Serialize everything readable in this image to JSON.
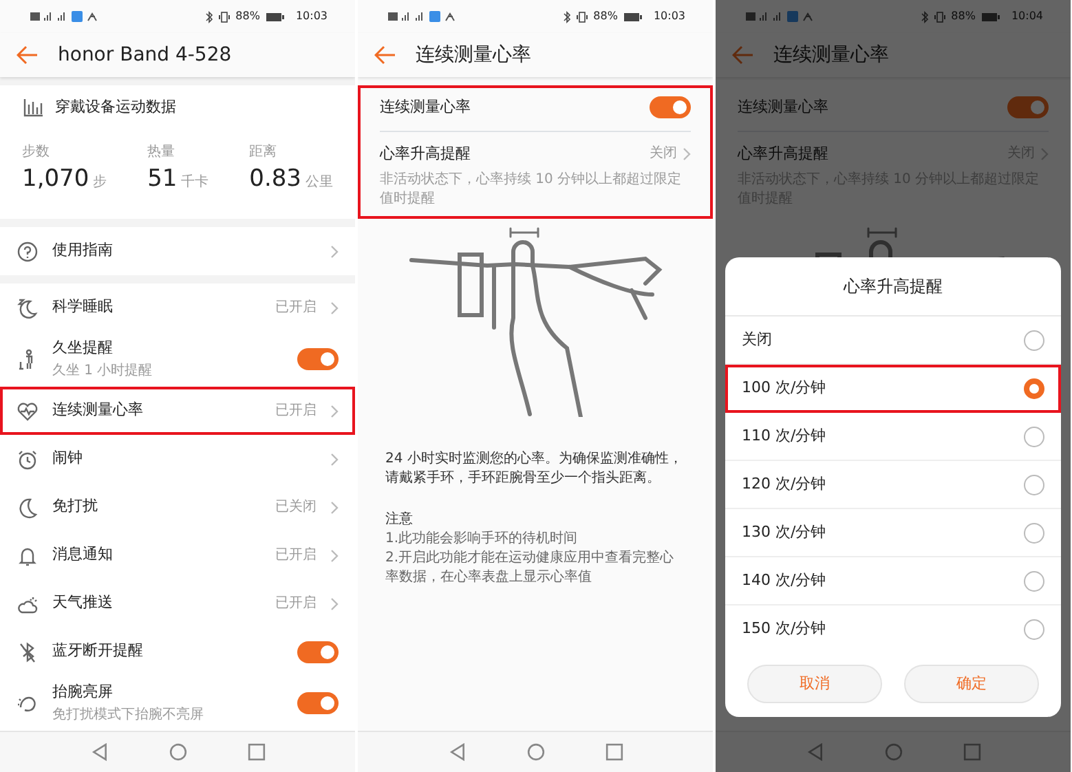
{
  "screens": [
    {
      "kind": "device",
      "status_bar": {
        "battery": "88%",
        "time": "10:03"
      },
      "header": {
        "title": "honor Band 4-528"
      },
      "stats": {
        "title": "穿戴设备运动数据",
        "metrics": [
          {
            "label": "步数",
            "value": "1,070",
            "unit": "步"
          },
          {
            "label": "热量",
            "value": "51",
            "unit": "千卡"
          },
          {
            "label": "距离",
            "value": "0.83",
            "unit": "公里"
          }
        ]
      },
      "guide": {
        "label": "使用指南"
      },
      "items": [
        {
          "kind": "link",
          "label": "科学睡眠",
          "value": "已开启",
          "highlighted": false
        },
        {
          "kind": "toggle",
          "label": "久坐提醒",
          "subtitle": "久坐 1 小时提醒",
          "on": true,
          "highlighted": false
        },
        {
          "kind": "link",
          "label": "连续测量心率",
          "value": "已开启",
          "highlighted": true
        },
        {
          "kind": "link",
          "label": "闹钟",
          "highlighted": false
        },
        {
          "kind": "link",
          "label": "免打扰",
          "value": "已关闭",
          "highlighted": false
        },
        {
          "kind": "link",
          "label": "消息通知",
          "value": "已开启",
          "highlighted": false
        },
        {
          "kind": "link",
          "label": "天气推送",
          "value": "已开启",
          "highlighted": false
        },
        {
          "kind": "toggle",
          "label": "蓝牙断开提醒",
          "on": true,
          "highlighted": false
        },
        {
          "kind": "toggle",
          "label": "抬腕亮屏",
          "subtitle": "免打扰模式下抬腕不亮屏",
          "on": true,
          "highlighted": false
        }
      ]
    },
    {
      "kind": "heart_rate",
      "status_bar": {
        "battery": "88%",
        "time": "10:03"
      },
      "header": {
        "title": "连续测量心率"
      },
      "settings": {
        "highlighted": true,
        "toggle": {
          "label": "连续测量心率",
          "on": true
        },
        "alert": {
          "label": "心率升高提醒",
          "value": "关闭",
          "description": "非活动状态下，心率持续 10 分钟以上都超过限定值时提醒"
        }
      },
      "intro": "24 小时实时监测您的心率。为确保监测准确性，请戴紧手环，手环距腕骨至少一个指头距离。",
      "notes": {
        "title": "注意",
        "lines": [
          "1.此功能会影响手环的待机时间",
          "2.开启此功能才能在运动健康应用中查看完整心率数据，在心率表盘上显示心率值"
        ]
      }
    },
    {
      "kind": "heart_rate",
      "status_bar": {
        "battery": "88%",
        "time": "10:04"
      },
      "header": {
        "title": "连续测量心率"
      },
      "settings": {
        "highlighted": false,
        "toggle": {
          "label": "连续测量心率",
          "on": true
        },
        "alert": {
          "label": "心率升高提醒",
          "value": "关闭",
          "description": "非活动状态下，心率持续 10 分钟以上都超过限定值时提醒"
        }
      },
      "dialog": {
        "title": "心率升高提醒",
        "options": [
          {
            "label": "关闭",
            "selected": false,
            "highlighted": false
          },
          {
            "label": "100 次/分钟",
            "selected": true,
            "highlighted": true
          },
          {
            "label": "110 次/分钟",
            "selected": false,
            "highlighted": false
          },
          {
            "label": "120 次/分钟",
            "selected": false,
            "highlighted": false
          },
          {
            "label": "130 次/分钟",
            "selected": false,
            "highlighted": false
          },
          {
            "label": "140 次/分钟",
            "selected": false,
            "highlighted": false
          },
          {
            "label": "150 次/分钟",
            "selected": false,
            "highlighted": false
          }
        ],
        "buttons": [
          "取消",
          "确定"
        ]
      }
    }
  ]
}
